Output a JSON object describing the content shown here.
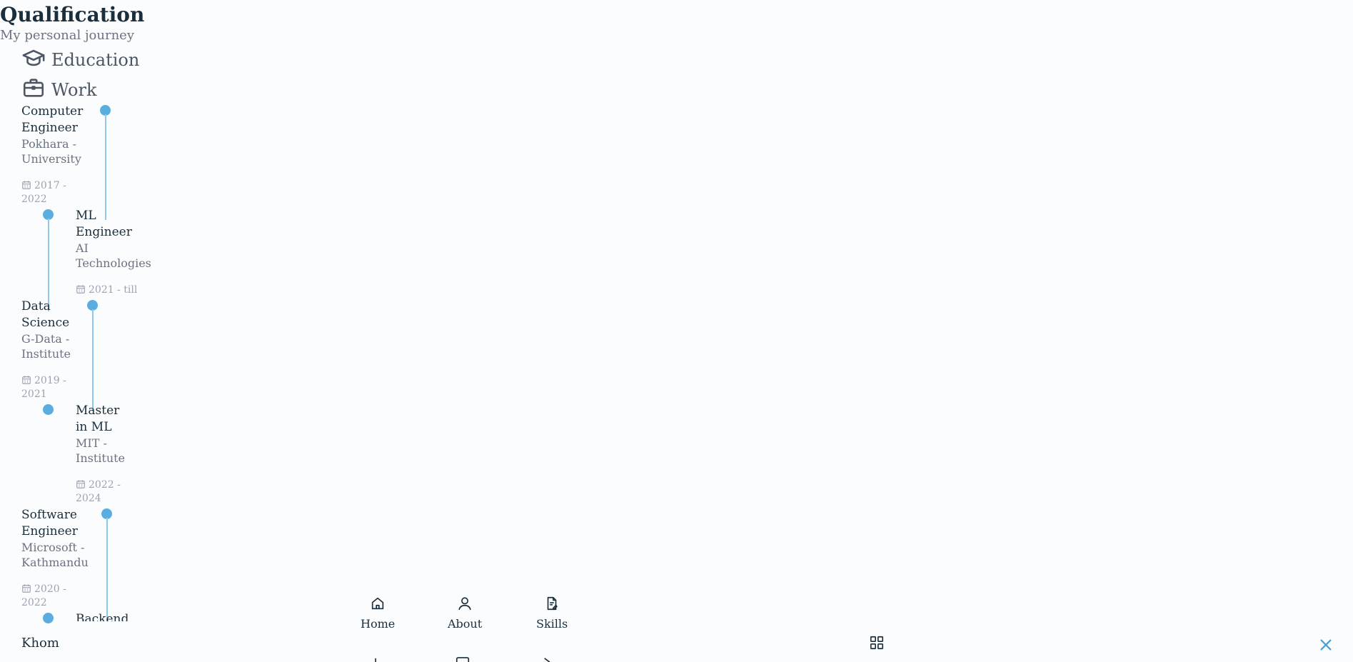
{
  "section": {
    "title": "Qualification",
    "subtitle": "My personal journey"
  },
  "tabs": [
    {
      "label": "Education",
      "icon": "graduation-cap-icon"
    },
    {
      "label": "Work",
      "icon": "briefcase-icon"
    }
  ],
  "entries": [
    {
      "title": "Computer Engineer",
      "subtitle": "Pokhara - University",
      "date": "2017 - 2022"
    },
    {
      "title": "ML Engineer",
      "subtitle": "AI Technologies",
      "date": "2021 - till"
    },
    {
      "title": "Data Science",
      "subtitle": "G-Data - Institute",
      "date": "2019 - 2021"
    },
    {
      "title": "Master in ML",
      "subtitle": "MIT - Institute",
      "date": "2022 - 2024"
    },
    {
      "title": "Software Engineer",
      "subtitle": "Microsoft - Kathmandu",
      "date": "2020 - 2022"
    },
    {
      "title": "Backend",
      "subtitle": "",
      "date": ""
    }
  ],
  "nav": {
    "logo": "Khom",
    "items": [
      {
        "label": "Home",
        "icon": "home-icon"
      },
      {
        "label": "About",
        "icon": "user-icon"
      },
      {
        "label": "Skills",
        "icon": "file-icon"
      }
    ],
    "grid_icon": "grid-icon",
    "close_icon": "close-icon"
  },
  "colors": {
    "accent": "#5aaddf",
    "line": "#8ec8ea",
    "text": "#1a2e3b",
    "muted": "#6b7280",
    "background": "#fbfcfe"
  }
}
